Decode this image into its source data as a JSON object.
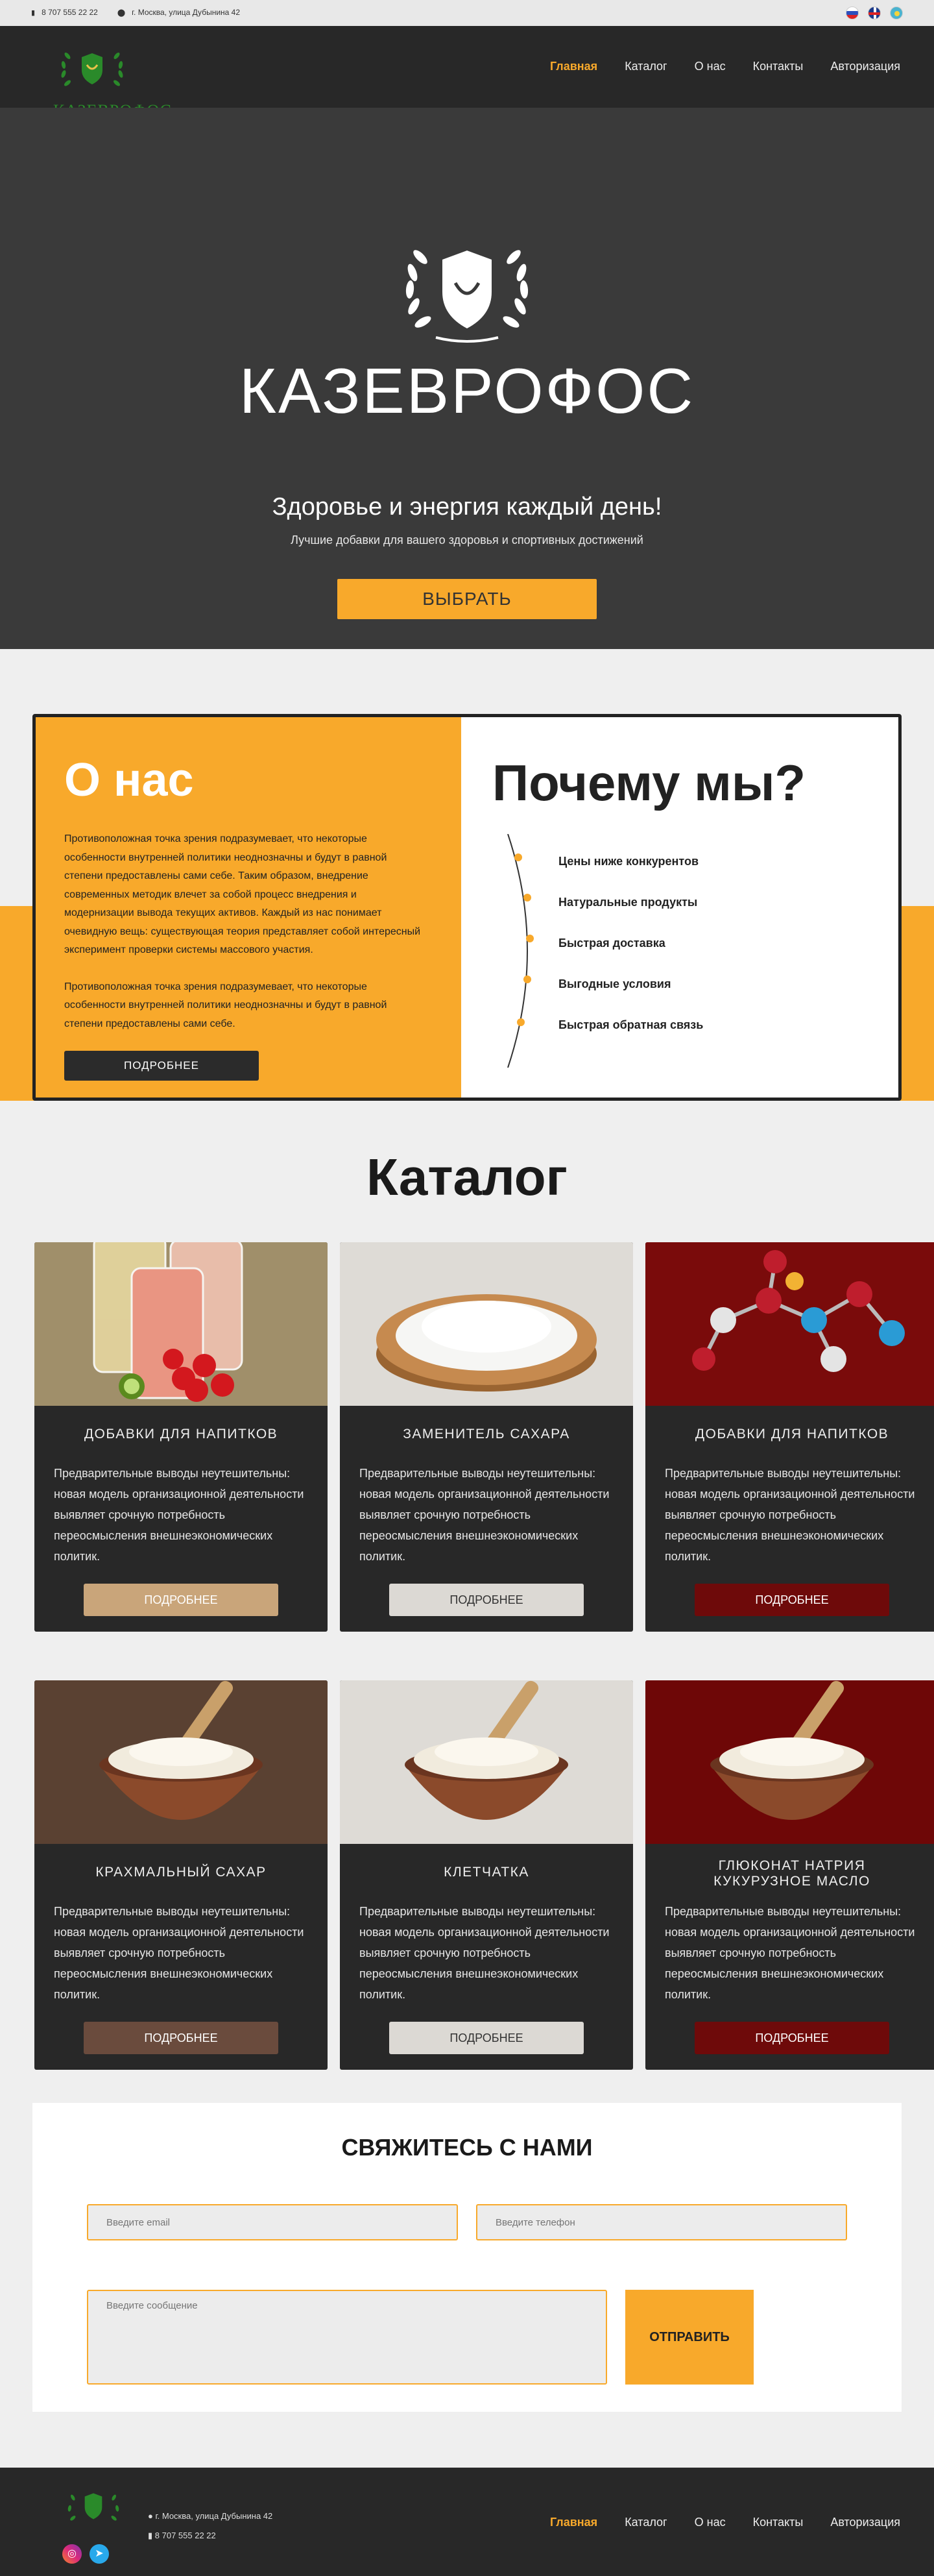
{
  "topbar": {
    "phone": "8 707 555 22 22",
    "address": "г. Москва, улица Дубынина 42",
    "languages": [
      "ru",
      "en",
      "kz"
    ]
  },
  "brand": {
    "name": "КАЗЕВРОФОС"
  },
  "nav": {
    "items": [
      "Главная",
      "Каталог",
      "О нас",
      "Контакты",
      "Авторизация"
    ],
    "active": "Главная"
  },
  "hero": {
    "title": "КАЗЕВРОФОС",
    "subtitle": "Здоровье и энергия каждый день!",
    "description": "Лучшие добавки для вашего здоровья и спортивных достижений",
    "button": "ВЫБРАТЬ"
  },
  "about": {
    "title": "О нас",
    "paragraph1": "Противоположная точка зрения подразумевает, что некоторые особенности внутренней политики неоднозначны и будут в равной степени предоставлены сами себе. Таким образом, внедрение современных методик влечет за собой процесс внедрения и модернизации вывода текущих активов. Каждый из нас понимает очевидную вещь: существующая теория представляет собой интересный эксперимент проверки системы массового участия.",
    "paragraph2": "Противоположная точка зрения подразумевает, что некоторые особенности внутренней политики неоднозначны и будут в равной степени предоставлены сами себе.",
    "button": "ПОДРОБНЕЕ"
  },
  "why": {
    "title": "Почему мы?",
    "items": [
      "Цены ниже конкурентов",
      "Натуральные продукты",
      "Быстрая доставка",
      "Выгодные условия",
      "Быстрая обратная связь"
    ]
  },
  "catalog": {
    "title": "Каталог",
    "cards": [
      {
        "title": "ДОБАВКИ ДЛЯ НАПИТКОВ",
        "desc": "Предварительные выводы неутешительны: новая модель организационной деятельности выявляет срочную потребность переосмысления внешнеэкономических политик.",
        "button": "ПОДРОБНЕЕ",
        "image": "drinks",
        "bg": "#a08f6a",
        "btn_color": "#c9a57a"
      },
      {
        "title": "ЗАМЕНИТЕЛЬ САХАРА",
        "desc": "Предварительные выводы неутешительны: новая модель организационной деятельности выявляет срочную потребность переосмысления внешнеэкономических политик.",
        "button": "ПОДРОБНЕЕ",
        "image": "sugar",
        "bg": "#dedbd6",
        "btn_color": "#dcd9d4"
      },
      {
        "title": "ДОБАВКИ ДЛЯ НАПИТКОВ",
        "desc": "Предварительные выводы неутешительны: новая модель организационной деятельности выявляет срочную потребность переосмысления внешнеэкономических политик.",
        "button": "ПОДРОБНЕЕ",
        "image": "molecule",
        "bg": "#7a0b0b",
        "btn_color": "#6e0a0a"
      },
      {
        "title": "КРАХМАЛЬНЫЙ САХАР",
        "desc": "Предварительные выводы неутешительны: новая модель организационной деятельности выявляет срочную потребность переосмысления внешнеэкономических политик.",
        "button": "ПОДРОБНЕЕ",
        "image": "bowl",
        "bg": "#5a4132",
        "btn_color": "#6a4b3d"
      },
      {
        "title": "КЛЕТЧАТКА",
        "desc": "Предварительные выводы неутешительны: новая модель организационной деятельности выявляет срочную потребность переосмысления внешнеэкономических политик.",
        "button": "ПОДРОБНЕЕ",
        "image": "bowl",
        "bg": "#dedbd6",
        "btn_color": "#dcd9d4"
      },
      {
        "title": "ГЛЮКОНАТ НАТРИЯ\nКУКУРУЗНОЕ МАСЛО",
        "desc": "Предварительные выводы неутешительны: новая модель организационной деятельности выявляет срочную потребность переосмысления внешнеэкономических политик.",
        "button": "ПОДРОБНЕЕ",
        "image": "bowl",
        "bg": "#6e0707",
        "btn_color": "#6e0a0a"
      }
    ]
  },
  "contact": {
    "title": "СВЯЖИТЕСЬ С НАМИ",
    "email_placeholder": "Введите email",
    "phone_placeholder": "Введите телефон",
    "message_placeholder": "Введите сообщение",
    "button": "ОТПРАВИТЬ"
  },
  "footer": {
    "address": "г. Москва, улица Дубынина 42",
    "phone": "8 707 555 22 22",
    "social": [
      "instagram",
      "telegram"
    ]
  },
  "colors": {
    "accent": "#f8a92b",
    "dark": "#282828",
    "hero": "#3a3a3a"
  }
}
